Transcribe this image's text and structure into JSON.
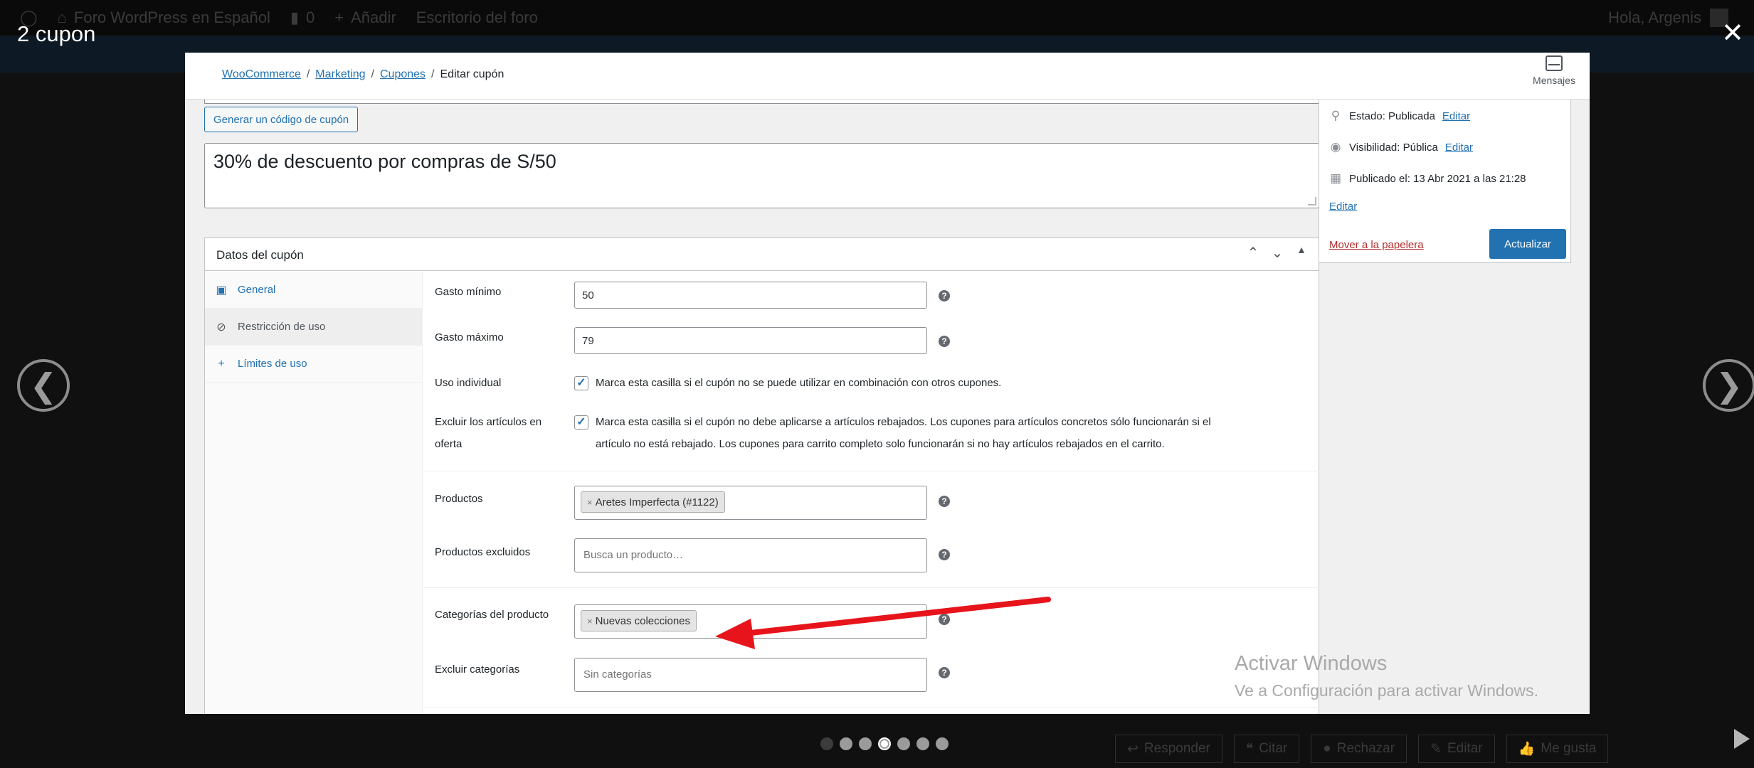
{
  "lightbox": {
    "title": "2 cupon",
    "close_glyph": "✕",
    "prev_glyph": "❮",
    "next_glyph": "❯",
    "dots": [
      {
        "state": "dim"
      },
      {
        "state": "normal"
      },
      {
        "state": "normal"
      },
      {
        "state": "active"
      },
      {
        "state": "normal"
      },
      {
        "state": "normal"
      },
      {
        "state": "normal"
      }
    ]
  },
  "background": {
    "adminbar": {
      "comment_count": "0",
      "add_label": "Añadir",
      "forum_name": "Foro WordPress en Español",
      "dashboard_label": "Escritorio del foro",
      "greeting": "Hola, Argenis"
    },
    "actions": [
      "Responder",
      "Citar",
      "Rechazar",
      "Editar",
      "Me gusta"
    ]
  },
  "woocommerce": {
    "breadcrumb": {
      "woocommerce": "WooCommerce",
      "marketing": "Marketing",
      "coupons": "Cupones",
      "current": "Editar cupón",
      "separator": "/"
    },
    "messages_label": "Mensajes",
    "generate_code_label": "Generar un código de cupón",
    "description": "30% de descuento por compras de S/50",
    "publish": {
      "status_label": "Estado: Publicada",
      "visibility_label": "Visibilidad: Pública",
      "published_label": "Publicado el: 13 Abr 2021 a las 21:28",
      "edit_label": "Editar",
      "trash_label": "Mover a la papelera",
      "update_label": "Actualizar"
    },
    "coupon_data": {
      "title": "Datos del cupón",
      "tabs": [
        {
          "label": "General",
          "icon": "ticket-icon",
          "glyph": "▣"
        },
        {
          "label": "Restricción de uso",
          "icon": "ban-icon",
          "glyph": "⊘"
        },
        {
          "label": "Límites de uso",
          "icon": "plus-icon",
          "glyph": "+"
        }
      ],
      "min_spend_label": "Gasto mínimo",
      "min_spend_value": "50",
      "max_spend_label": "Gasto máximo",
      "max_spend_value": "79",
      "individual_use_label": "Uso individual",
      "individual_use_checked": true,
      "individual_use_desc": "Marca esta casilla si el cupón no se puede utilizar en combinación con otros cupones.",
      "exclude_sale_label_1": "Excluir los artículos en",
      "exclude_sale_label_2": "oferta",
      "exclude_sale_checked": true,
      "exclude_sale_desc_1": "Marca esta casilla si el cupón no debe aplicarse a artículos rebajados. Los cupones para artículos concretos sólo funcionarán si el",
      "exclude_sale_desc_2": "artículo no está rebajado. Los cupones para carrito completo solo funcionarán si no hay artículos rebajados en el carrito.",
      "products_label": "Productos",
      "products_chip": "Aretes Imperfecta (#1122)",
      "excluded_products_label": "Productos excluidos",
      "excluded_products_placeholder": "Busca un producto…",
      "categories_label": "Categorías del producto",
      "categories_chip": "Nuevas colecciones",
      "exclude_categories_label": "Excluir categorías",
      "exclude_categories_placeholder": "Sin categorías",
      "chip_remove_glyph": "×",
      "help_glyph": "?",
      "check_glyph": "✓"
    }
  },
  "watermark": {
    "line1": "Activar Windows",
    "line2": "Ve a Configuración para activar Windows."
  },
  "colors": {
    "accent": "#2271b1",
    "danger": "#b32d2e",
    "annotation_arrow": "#e8141b"
  }
}
